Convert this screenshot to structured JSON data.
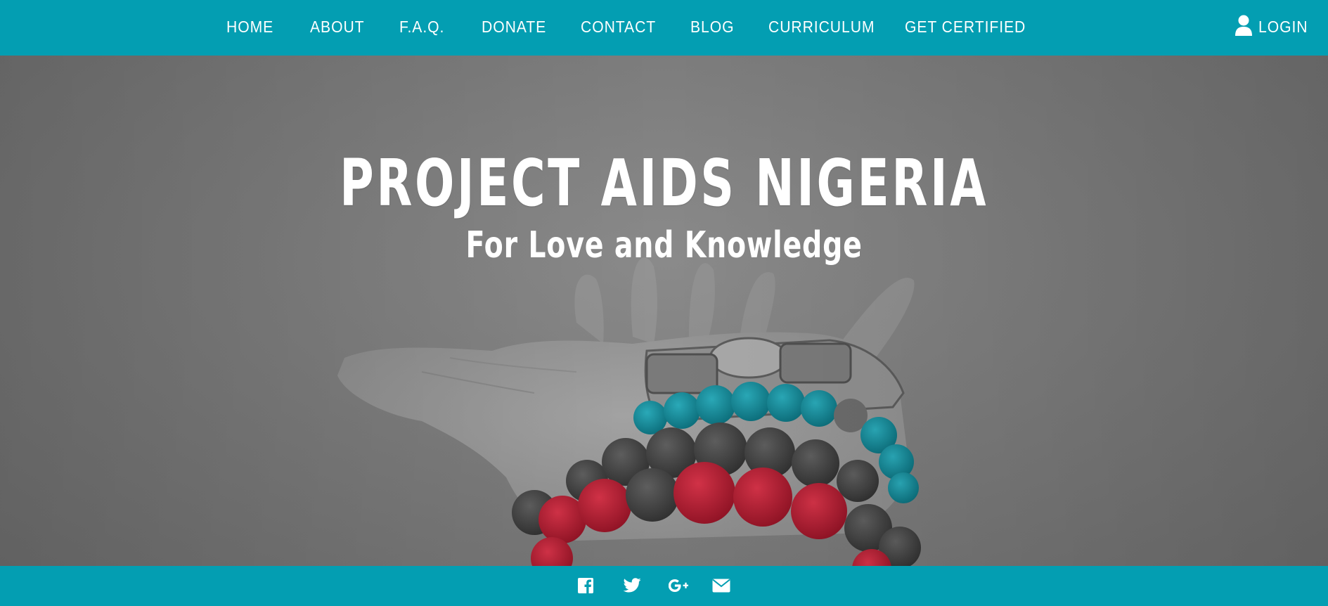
{
  "nav": {
    "items": [
      {
        "label": "HOME"
      },
      {
        "label": "ABOUT"
      },
      {
        "label": "F.A.Q."
      },
      {
        "label": "DONATE"
      },
      {
        "label": "CONTACT"
      },
      {
        "label": "BLOG"
      },
      {
        "label": "CURRICULUM"
      },
      {
        "label": "GET CERTIFIED"
      }
    ],
    "login_label": "LOGIN"
  },
  "hero": {
    "title": "PROJECT AIDS NIGERIA",
    "subtitle": "For Love and Knowledge"
  },
  "footer": {
    "social": [
      {
        "icon": "facebook-icon"
      },
      {
        "icon": "twitter-icon"
      },
      {
        "icon": "google-plus-icon"
      },
      {
        "icon": "email-icon"
      }
    ]
  },
  "colors": {
    "brand": "#039eb2",
    "beads_teal": "#14808f",
    "beads_red": "#b01f33"
  }
}
